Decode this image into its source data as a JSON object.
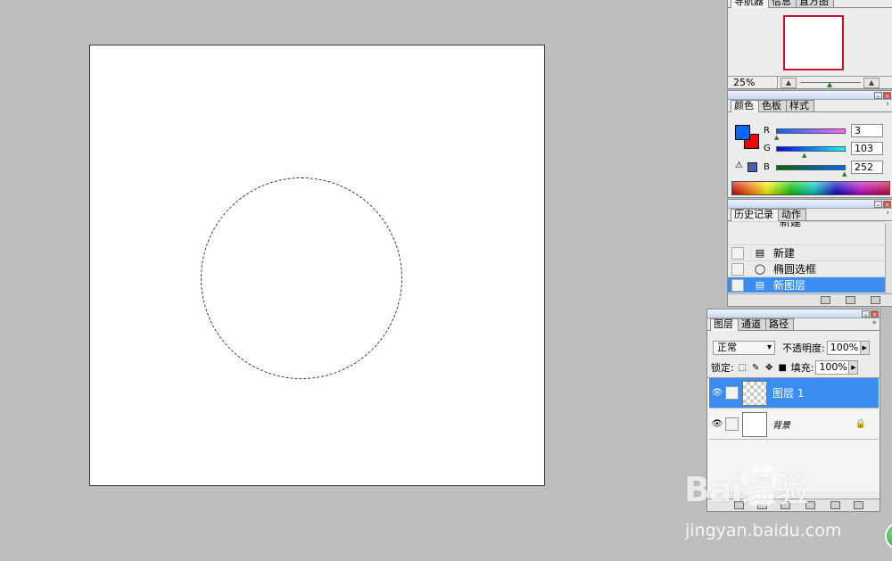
{
  "navigator": {
    "tabs": [
      "导航器",
      "信息",
      "直方图"
    ],
    "zoom": "25%"
  },
  "color": {
    "tabs": [
      "颜色",
      "色板",
      "样式"
    ],
    "foreground": "#0367fc",
    "background": "#ff0000",
    "channels": [
      {
        "label": "R",
        "value": "3"
      },
      {
        "label": "G",
        "value": "103"
      },
      {
        "label": "B",
        "value": "252"
      }
    ]
  },
  "history": {
    "tabs": [
      "历史记录",
      "动作"
    ],
    "partial_item": "新建",
    "items": [
      "新建",
      "椭圆选框",
      "新图层"
    ]
  },
  "layers": {
    "tabs": [
      "图层",
      "通道",
      "路径"
    ],
    "blend_mode": "正常",
    "opacity_label": "不透明度:",
    "opacity": "100%",
    "lock_label": "锁定:",
    "fill_label": "填充:",
    "fill": "100%",
    "items": [
      "图层 1",
      "背景"
    ]
  },
  "watermark": {
    "text": "Bai经验",
    "url": "jingyan.baidu.com"
  }
}
